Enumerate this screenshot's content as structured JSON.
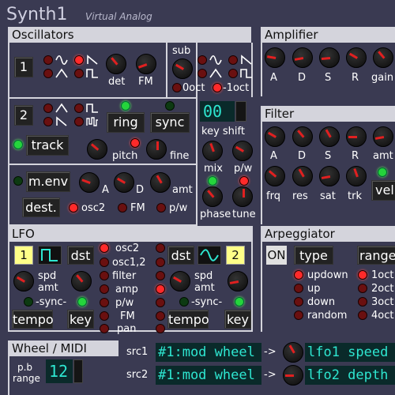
{
  "app": {
    "title": "Synth1",
    "subtitle": "Virtual Analog"
  },
  "sections": {
    "oscillators": "Oscillators",
    "amplifier": "Amplifier",
    "filter": "Filter",
    "lfo": "LFO",
    "arpeggiator": "Arpeggiator",
    "wheel": "Wheel / MIDI"
  },
  "osc1": {
    "number": "1",
    "det": "det",
    "fm": "FM",
    "sub": "sub",
    "oct0": "0oct",
    "oct1": "-1oct"
  },
  "osc2": {
    "number": "2",
    "ring": "ring",
    "sync": "sync",
    "track": "track",
    "pitch": "pitch",
    "fine": "fine",
    "keyshift_value": "00",
    "keyshift": "key shift"
  },
  "mix": {
    "mix": "mix",
    "pw": "p/w",
    "phase": "phase",
    "tune": "tune"
  },
  "menv": {
    "button": "m.env",
    "a": "A",
    "d": "D",
    "amt": "amt",
    "dest": "dest.",
    "osc2": "osc2",
    "fm": "FM",
    "pw": "p/w"
  },
  "amplifier": {
    "labels": [
      "A",
      "D",
      "S",
      "R",
      "gain"
    ]
  },
  "filter": {
    "labels_row1": [
      "A",
      "D",
      "S",
      "R",
      "amt"
    ],
    "labels_row2": [
      "frq",
      "res",
      "sat",
      "trk"
    ],
    "vel": "vel"
  },
  "lfo": {
    "lfo1_num": "1",
    "lfo2_num": "2",
    "dst": "dst",
    "spd": "spd",
    "amt": "amt",
    "sync": "-sync-",
    "tempo": "tempo",
    "key": "key",
    "destinations": [
      "osc2",
      "osc1,2",
      "filter",
      "amp",
      "p/w",
      "FM",
      "pan"
    ]
  },
  "arp": {
    "on": "ON",
    "type": "type",
    "range": "range",
    "types": [
      "updown",
      "up",
      "down",
      "random"
    ],
    "ranges": [
      "1oct",
      "2oct",
      "3oct",
      "4oct"
    ]
  },
  "wheel": {
    "pb_label": "p.b",
    "range_label": "range",
    "pb_value": "12",
    "src1": "src1",
    "src2": "src2",
    "src1_value": "#1:mod wheel",
    "src2_value": "#1:mod wheel",
    "arrow": "->",
    "dst1_value": "lfo1 speed",
    "dst2_value": "lfo2 depth"
  },
  "colors": {
    "background": "#3a3a52",
    "header": "#d4d4dc",
    "led_on": "#ff2a2a",
    "led_green": "#25d43c",
    "lcd_text": "#2ee6d0",
    "knob_pointer": "#e02020"
  }
}
